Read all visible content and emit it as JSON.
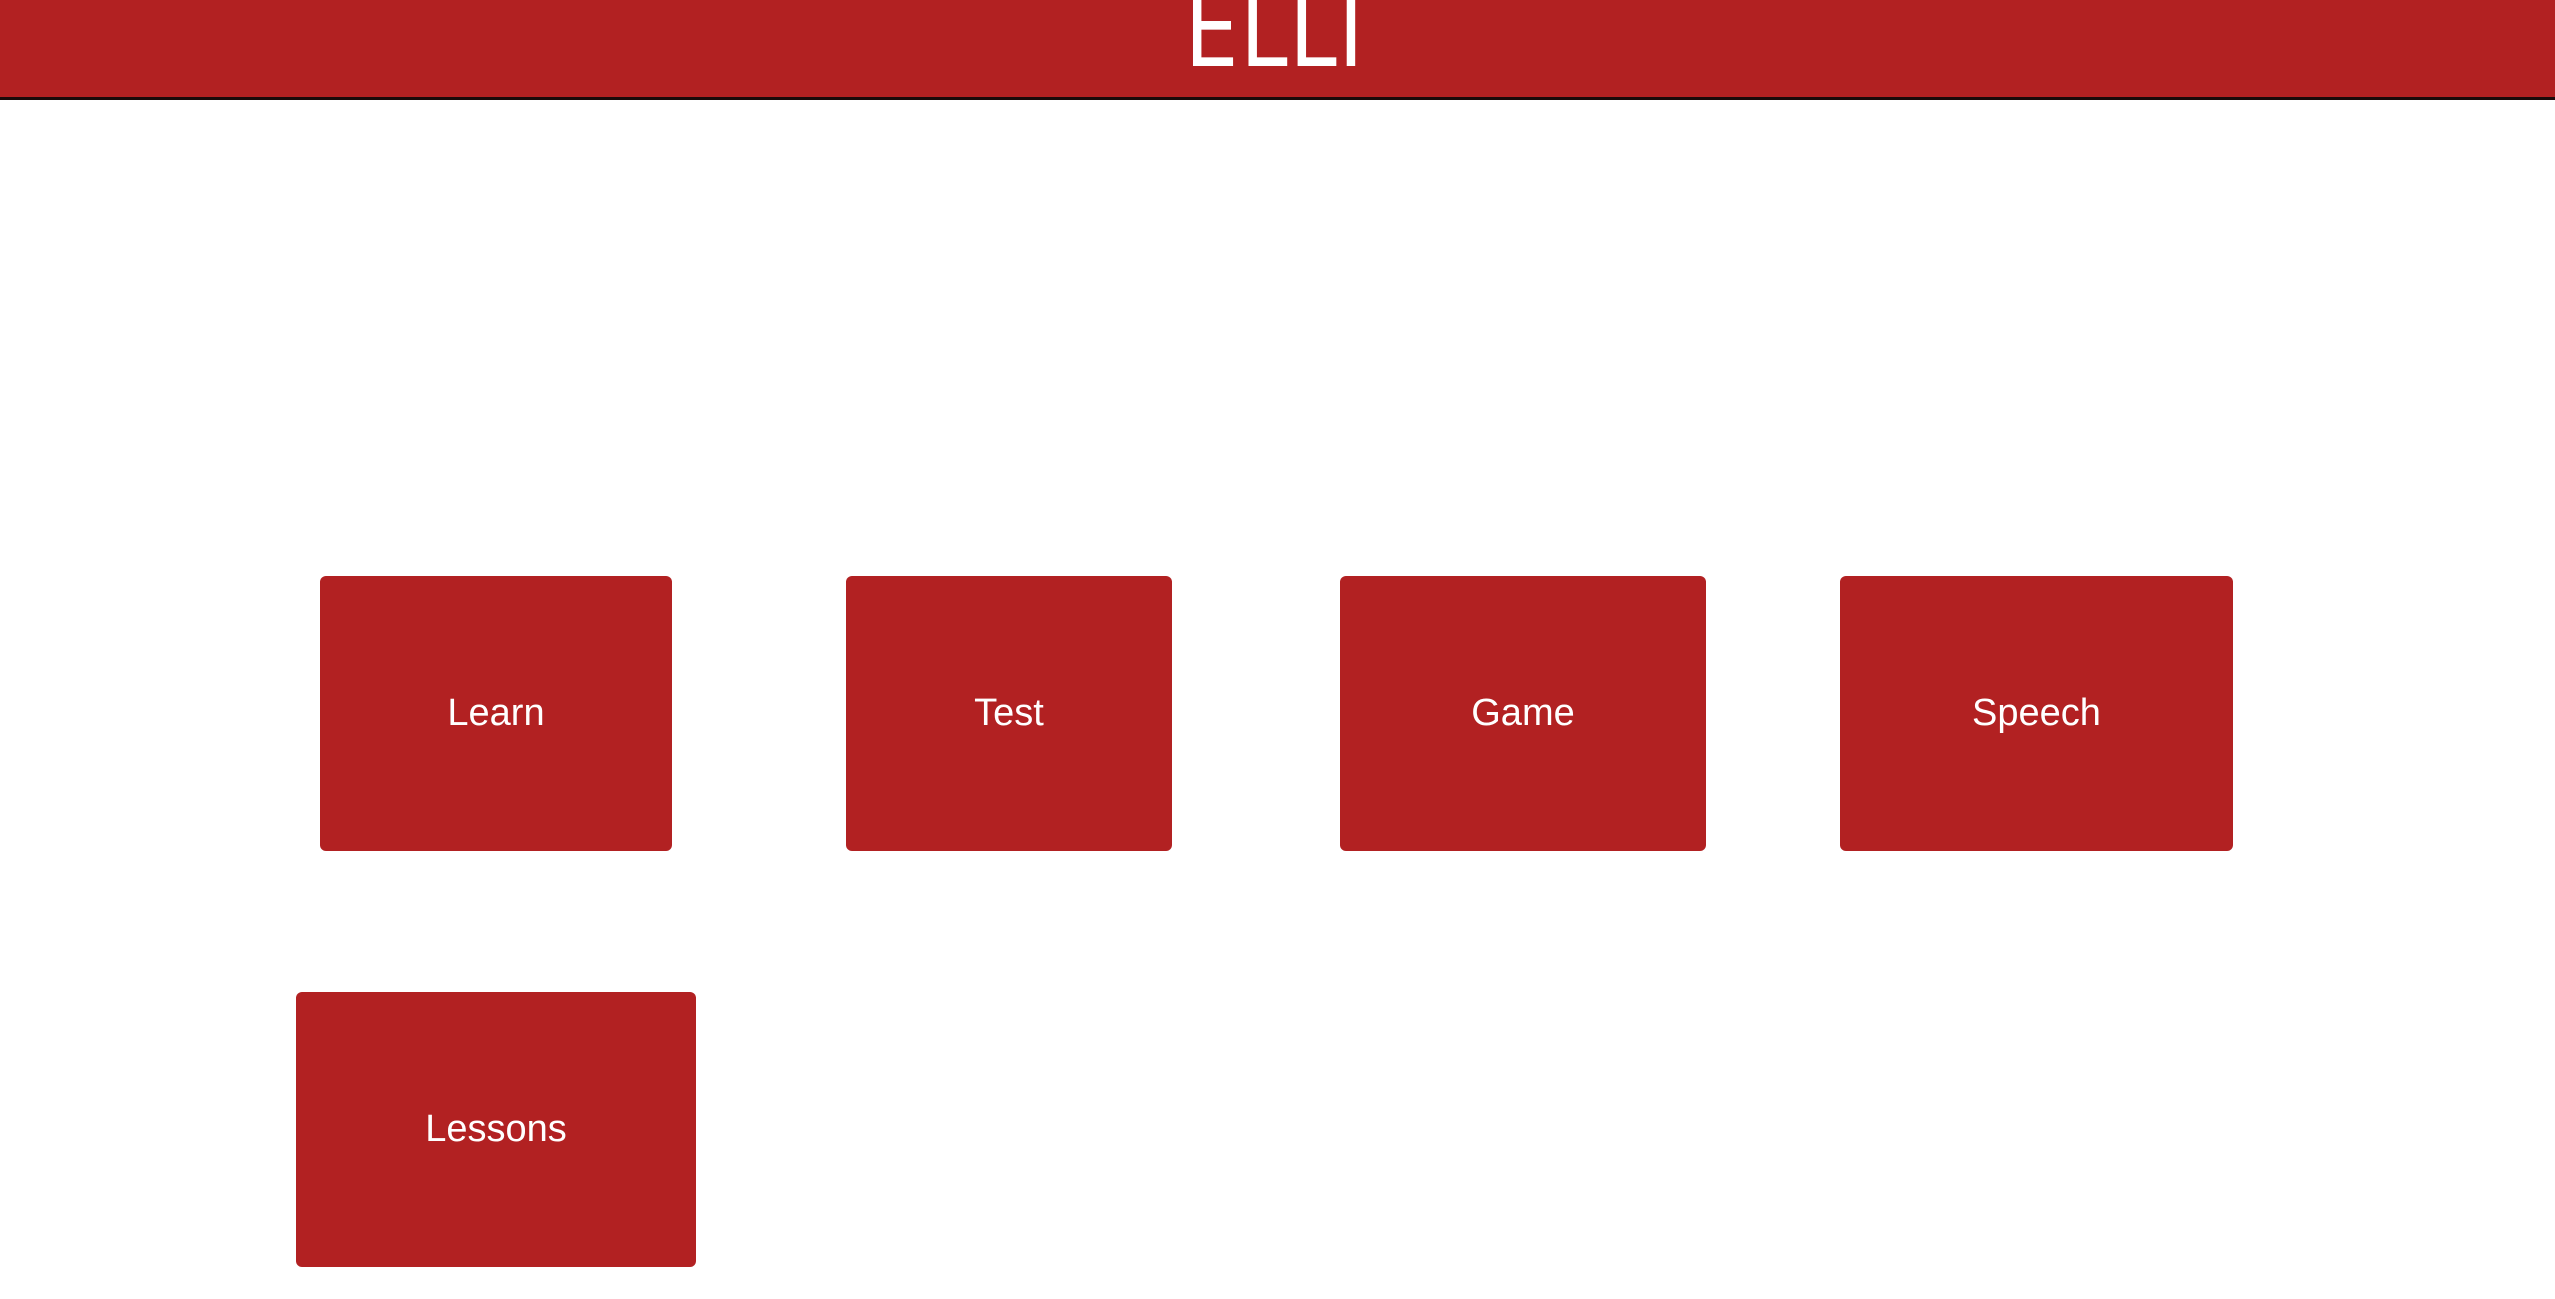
{
  "header": {
    "title": "ELLI",
    "background_color": "#b22122"
  },
  "menu": {
    "tile_color": "#b22122",
    "text_color": "#ffffff",
    "items": [
      {
        "label": "Learn"
      },
      {
        "label": "Test"
      },
      {
        "label": "Game"
      },
      {
        "label": "Speech"
      },
      {
        "label": "Lessons"
      }
    ]
  }
}
